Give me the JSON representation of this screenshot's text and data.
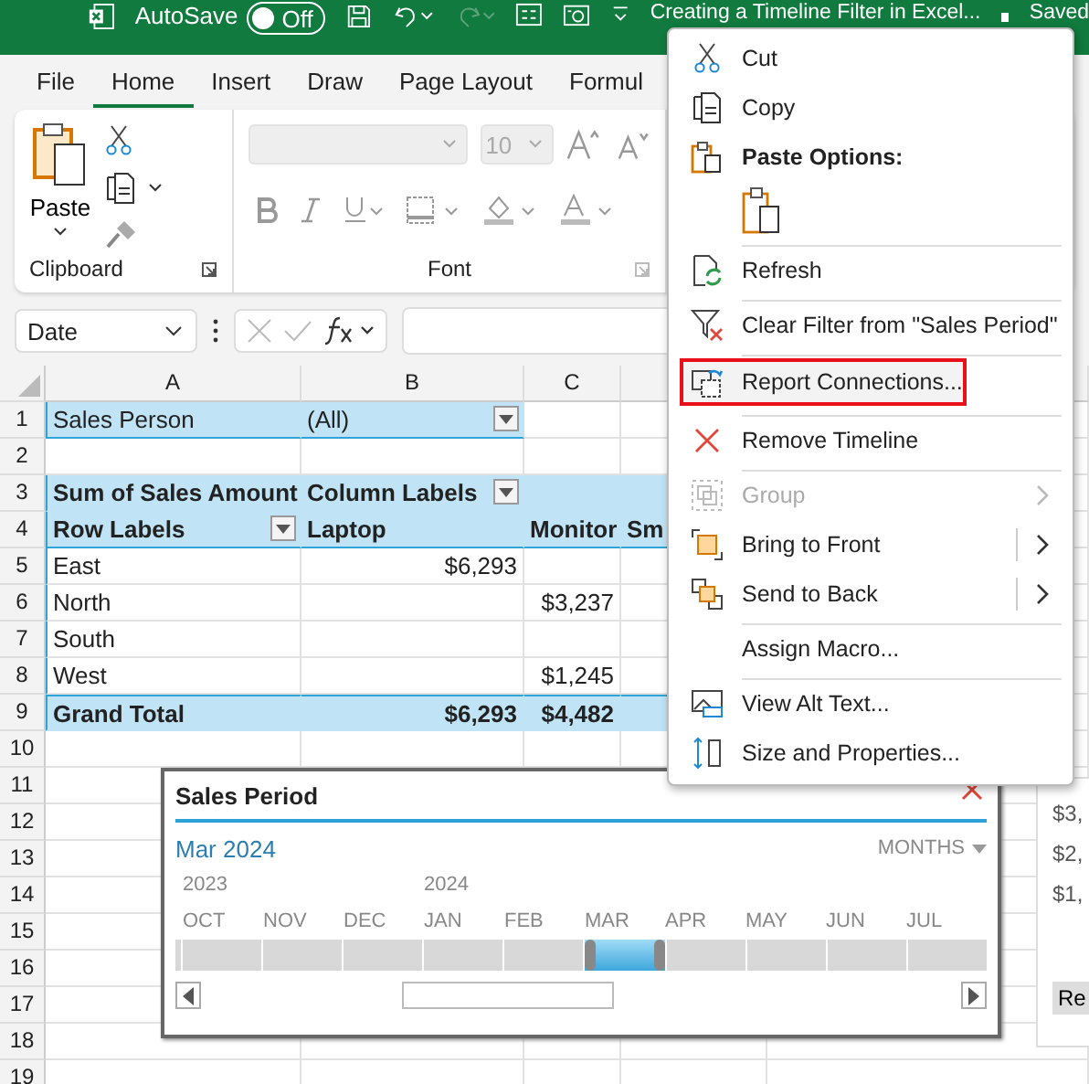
{
  "title_bar": {
    "autosave_label": "AutoSave",
    "autosave": {
      "on": false,
      "label": "Off"
    },
    "document_title": "Creating a Timeline Filter in Excel...",
    "save_status": "Saved"
  },
  "ribbon_tabs": [
    {
      "label": "File",
      "selected": false
    },
    {
      "label": "Home",
      "selected": true
    },
    {
      "label": "Insert",
      "selected": false
    },
    {
      "label": "Draw",
      "selected": false
    },
    {
      "label": "Page Layout",
      "selected": false
    },
    {
      "label": "Formul",
      "selected": false
    }
  ],
  "ribbon": {
    "clipboard": {
      "paste_label": "Paste",
      "group_label": "Clipboard"
    },
    "font": {
      "font_size": "10",
      "group_label": "Font"
    }
  },
  "formula_bar": {
    "name_box": "Date"
  },
  "sheet": {
    "columns": [
      "A",
      "B",
      "C"
    ],
    "rows": [
      {
        "number": "1",
        "kind": "filter",
        "cells": [
          {
            "text": "Sales Person",
            "kind": "label"
          },
          {
            "text": "(All)",
            "kind": "label",
            "dropdown": true
          }
        ]
      },
      {
        "number": "2",
        "kind": "empty",
        "cells": []
      },
      {
        "number": "3",
        "kind": "header",
        "cells": [
          {
            "text": "Sum of Sales Amount",
            "kind": "label"
          },
          {
            "text": "Column Labels",
            "kind": "label",
            "dropdown": true
          }
        ]
      },
      {
        "number": "4",
        "kind": "subheader",
        "cells": [
          {
            "text": "Row Labels",
            "kind": "label",
            "dropdown": true
          },
          {
            "text": "Laptop",
            "kind": "label"
          },
          {
            "text": "Monitor",
            "kind": "label"
          },
          {
            "text": "Sm",
            "kind": "label"
          }
        ]
      },
      {
        "number": "5",
        "kind": "data",
        "cells": [
          {
            "text": "East",
            "kind": "label"
          },
          {
            "text": "$6,293",
            "kind": "value"
          }
        ]
      },
      {
        "number": "6",
        "kind": "data",
        "cells": [
          {
            "text": "North",
            "kind": "label"
          },
          {
            "text": "",
            "kind": "value"
          },
          {
            "text": "$3,237",
            "kind": "value"
          }
        ]
      },
      {
        "number": "7",
        "kind": "data",
        "cells": [
          {
            "text": "South",
            "kind": "label"
          }
        ]
      },
      {
        "number": "8",
        "kind": "data",
        "cells": [
          {
            "text": "West",
            "kind": "label"
          },
          {
            "text": "",
            "kind": "value"
          },
          {
            "text": "$1,245",
            "kind": "value"
          }
        ]
      },
      {
        "number": "9",
        "kind": "total",
        "cells": [
          {
            "text": "Grand Total",
            "kind": "label"
          },
          {
            "text": "$6,293",
            "kind": "value"
          },
          {
            "text": "$4,482",
            "kind": "value"
          }
        ]
      },
      {
        "number": "10",
        "kind": "empty",
        "cells": []
      },
      {
        "number": "11",
        "kind": "empty",
        "cells": []
      },
      {
        "number": "12",
        "kind": "empty",
        "cells": []
      },
      {
        "number": "13",
        "kind": "empty",
        "cells": []
      },
      {
        "number": "14",
        "kind": "empty",
        "cells": []
      },
      {
        "number": "15",
        "kind": "empty",
        "cells": []
      },
      {
        "number": "16",
        "kind": "empty",
        "cells": []
      },
      {
        "number": "17",
        "kind": "empty",
        "cells": []
      },
      {
        "number": "18",
        "kind": "empty",
        "cells": []
      },
      {
        "number": "19",
        "kind": "empty",
        "cells": []
      }
    ]
  },
  "chart_fragment": {
    "axis_labels": [
      "$3,",
      "$2,",
      "$1,"
    ],
    "button": "Re"
  },
  "timeline": {
    "title": "Sales Period",
    "current": "Mar 2024",
    "level_label": "MONTHS",
    "periods": [
      {
        "month": "OCT",
        "year": "2023",
        "selected": false
      },
      {
        "month": "NOV",
        "selected": false
      },
      {
        "month": "DEC",
        "selected": false
      },
      {
        "month": "JAN",
        "year": "2024",
        "selected": false
      },
      {
        "month": "FEB",
        "selected": false
      },
      {
        "month": "MAR",
        "selected": true
      },
      {
        "month": "APR",
        "selected": false
      },
      {
        "month": "MAY",
        "selected": false
      },
      {
        "month": "JUN",
        "selected": false
      },
      {
        "month": "JUL",
        "selected": false
      }
    ]
  },
  "context_menu": [
    {
      "kind": "item",
      "label": "Cut"
    },
    {
      "kind": "item",
      "label": "Copy"
    },
    {
      "kind": "header",
      "label": "Paste Options:"
    },
    {
      "kind": "paste-options"
    },
    {
      "kind": "item",
      "label": "Refresh",
      "separator_before": true
    },
    {
      "kind": "item",
      "label": "Clear Filter from \"Sales Period\"",
      "separator_before": true
    },
    {
      "kind": "item",
      "label": "Report Connections...",
      "separator_before": true,
      "highlighted": true
    },
    {
      "kind": "item",
      "label": "Remove Timeline",
      "separator_before": true
    },
    {
      "kind": "item",
      "label": "Group",
      "separator_before": true,
      "disabled": true,
      "submenu": true
    },
    {
      "kind": "item",
      "label": "Bring to Front",
      "submenu": true,
      "split": true
    },
    {
      "kind": "item",
      "label": "Send to Back",
      "submenu": true,
      "split": true
    },
    {
      "kind": "item",
      "label": "Assign Macro...",
      "separator_before": true
    },
    {
      "kind": "item",
      "label": "View Alt Text...",
      "separator_before": true
    },
    {
      "kind": "item",
      "label": "Size and Properties..."
    }
  ]
}
